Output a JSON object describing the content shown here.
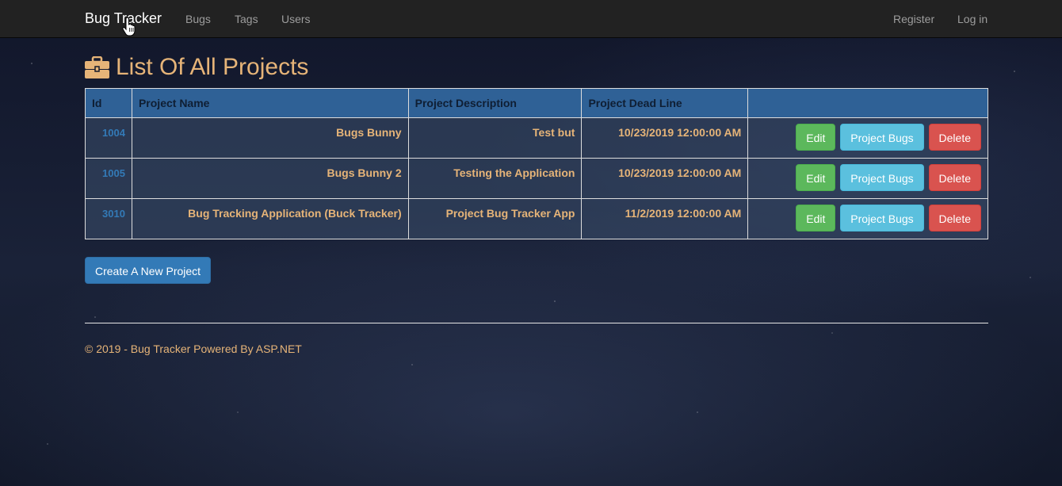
{
  "navbar": {
    "brand": "Bug Tracker",
    "links": [
      "Bugs",
      "Tags",
      "Users"
    ],
    "right_links": [
      "Register",
      "Log in"
    ]
  },
  "page": {
    "title": "List Of All Projects",
    "title_icon": "briefcase-icon"
  },
  "table": {
    "headers": [
      "Id",
      "Project Name",
      "Project Description",
      "Project Dead Line",
      ""
    ],
    "rows": [
      {
        "id": "1004",
        "name": "Bugs Bunny",
        "description": "Test but",
        "deadline": "10/23/2019 12:00:00 AM"
      },
      {
        "id": "1005",
        "name": "Bugs Bunny 2",
        "description": "Testing the Application",
        "deadline": "10/23/2019 12:00:00 AM"
      },
      {
        "id": "3010",
        "name": "Bug Tracking Application (Buck Tracker)",
        "description": "Project Bug Tracker App",
        "deadline": "11/2/2019 12:00:00 AM"
      }
    ],
    "actions": {
      "edit": "Edit",
      "bugs": "Project Bugs",
      "delete": "Delete"
    }
  },
  "create_button": "Create A New Project",
  "footer": "© 2019 - Bug Tracker Powered By ASP.NET",
  "colors": {
    "navbar": "#222222",
    "accent_text": "#e6b478",
    "table_header": "#2f6196",
    "link_blue": "#337ab7",
    "edit_green": "#5cb85c",
    "info_cyan": "#5bc0de",
    "danger_red": "#d9534f"
  }
}
